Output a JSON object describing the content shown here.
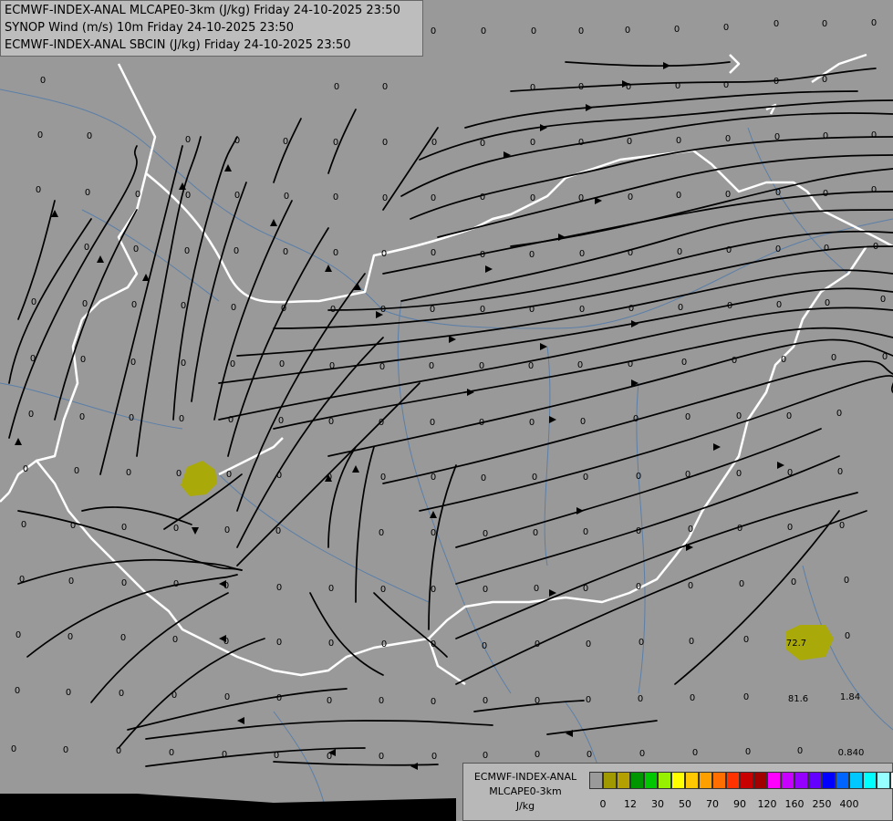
{
  "title_lines": [
    "ECMWF-INDEX-ANAL MLCAPE0-3km (J/kg) Friday 24-10-2025 23:50",
    "SYNOP Wind (m/s) 10m Friday 24-10-2025 23:50",
    "ECMWF-INDEX-ANAL SBCIN (J/kg) Friday 24-10-2025 23:50"
  ],
  "legend": {
    "title_lines": [
      "ECMWF-INDEX-ANAL",
      "MLCAPE0-3km",
      "J/kg"
    ],
    "colors": [
      "#9a9a9a",
      "#a09a00",
      "#b4a000",
      "#009600",
      "#00c800",
      "#96f000",
      "#ffff00",
      "#ffc800",
      "#ffa000",
      "#ff6e00",
      "#ff3200",
      "#c80000",
      "#a00000",
      "#ff00ff",
      "#c800ff",
      "#9600ff",
      "#6400ff",
      "#0000ff",
      "#0064ff",
      "#00c8ff",
      "#00ffff",
      "#96ffff",
      "#ffffff"
    ],
    "ticks": [
      "0",
      "12",
      "30",
      "50",
      "70",
      "90",
      "120",
      "160",
      "250",
      "400"
    ]
  },
  "cape_labels": [
    "72.7"
  ],
  "nonzero_values": [
    "81.6",
    "1.84",
    "0.840"
  ],
  "zero_value": "0",
  "colors": {
    "background": "#999999",
    "streamline": "#000000",
    "border": "#ffffff",
    "river": "#5b7fa8",
    "cape_low": "#a9a90a"
  }
}
